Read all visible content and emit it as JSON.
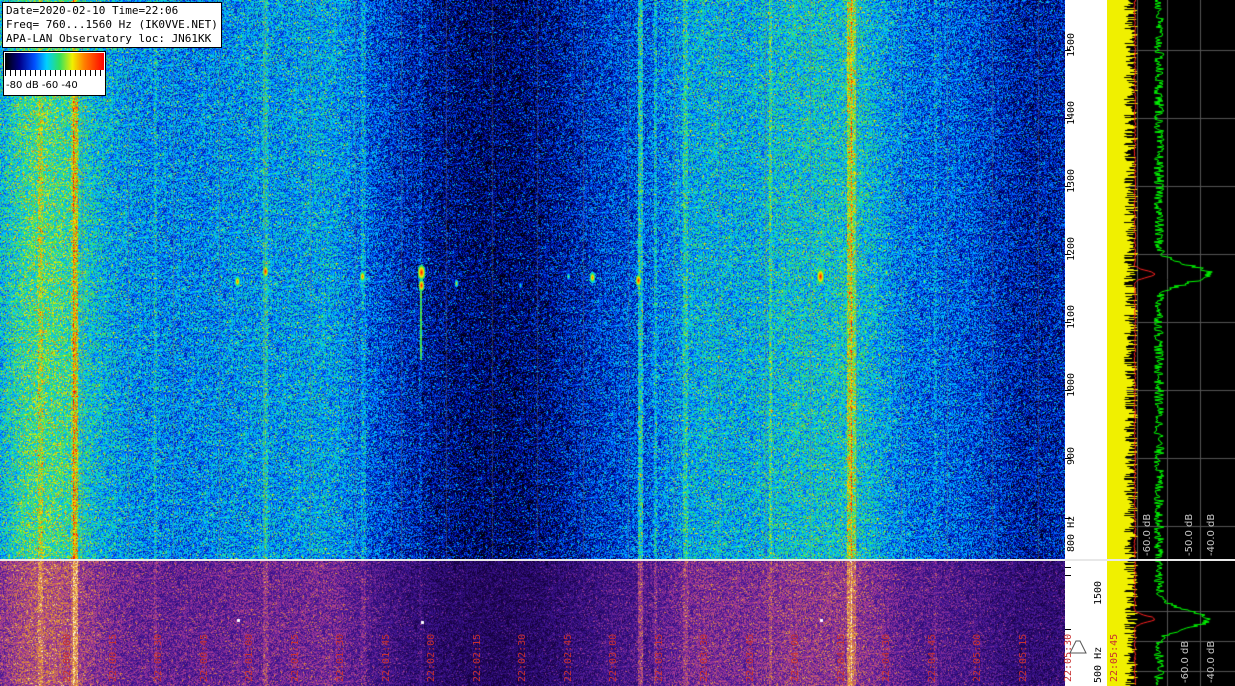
{
  "info": {
    "line1": "Date=2020-02-10 Time=22:06",
    "line2": "Freq= 760...1560 Hz (IK0VVE.NET)",
    "line3": "APA-LAN Observatory loc: JN61KK"
  },
  "legend": {
    "labels": "-80 dB -60    -40",
    "colors": [
      "#000000",
      "#00008a",
      "#0050ff",
      "#00d0ff",
      "#30e060",
      "#f0f000",
      "#ff8000",
      "#ff0000"
    ]
  },
  "freq_axis": {
    "ticks": [
      "1500",
      "1400",
      "1300",
      "1200",
      "1100",
      "1000",
      "900",
      "800 Hz"
    ]
  },
  "freq_axis_bottom": {
    "ticks": [
      "1500",
      "500 Hz"
    ]
  },
  "spectrum": {
    "db_labels": [
      "-60.0 dB",
      "-50.0 dB",
      "-40.0 dB"
    ],
    "db_labels_bottom": [
      "-60.0 dB",
      "-40.0 dB"
    ],
    "colors": {
      "avg": "#f0f000",
      "peak": "#00ff00",
      "ref": "#ff2020"
    }
  },
  "time_axis": {
    "labels": [
      "22:00:00",
      "22:00:15",
      "22:00:30",
      "22:00:45",
      "22:01:00",
      "22:01:15",
      "22:01:30",
      "22:01:45",
      "22:02:00",
      "22:02:15",
      "22:02:30",
      "22:02:45",
      "22:03:00",
      "22:03:15",
      "22:03:30",
      "22:03:45",
      "22:04:00",
      "22:04:15",
      "22:04:30",
      "22:04:45",
      "22:05:00",
      "22:05:15",
      "22:05:30",
      "22:05:45"
    ]
  }
}
